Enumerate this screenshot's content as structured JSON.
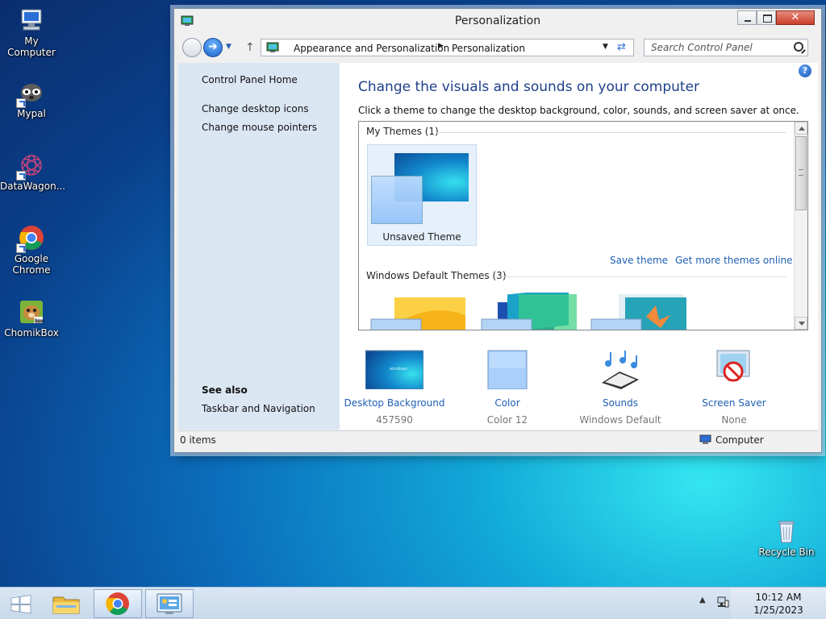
{
  "desktop": {
    "icons": [
      {
        "label": "My Computer"
      },
      {
        "label": "Mypal"
      },
      {
        "label": "DataWagon..."
      },
      {
        "label": "Google Chrome"
      },
      {
        "label": "ChomikBox"
      },
      {
        "label": "Recycle Bin"
      }
    ]
  },
  "window": {
    "title": "Personalization",
    "address": {
      "crumbs": [
        "Appearance and Personalization",
        "Personalization"
      ],
      "search_placeholder": "Search Control Panel"
    },
    "sidebar": {
      "links": [
        "Control Panel Home",
        "Change desktop icons",
        "Change mouse pointers"
      ],
      "see_also_title": "See also",
      "see_also_links": [
        "Taskbar and Navigation"
      ]
    },
    "main": {
      "heading": "Change the visuals and sounds on your computer",
      "description": "Click a theme to change the desktop background, color, sounds, and screen saver at once.",
      "my_themes_header": "My Themes (1)",
      "unsaved_theme_label": "Unsaved Theme",
      "save_theme_link": "Save theme",
      "get_more_link": "Get more themes online",
      "default_themes_header": "Windows Default Themes (3)",
      "help_glyph": "?"
    },
    "settings": [
      {
        "label": "Desktop Background",
        "sub": "457590"
      },
      {
        "label": "Color",
        "sub": "Color 12"
      },
      {
        "label": "Sounds",
        "sub": "Windows Default"
      },
      {
        "label": "Screen Saver",
        "sub": "None"
      }
    ],
    "status": {
      "items": "0 items",
      "location": "Computer"
    }
  },
  "taskbar": {
    "clock_time": "10:12 AM",
    "clock_date": "1/25/2023"
  },
  "colors": {
    "link": "#1f5fb3",
    "heading": "#1e3f8a",
    "sidebar": "#dbe6f3"
  }
}
